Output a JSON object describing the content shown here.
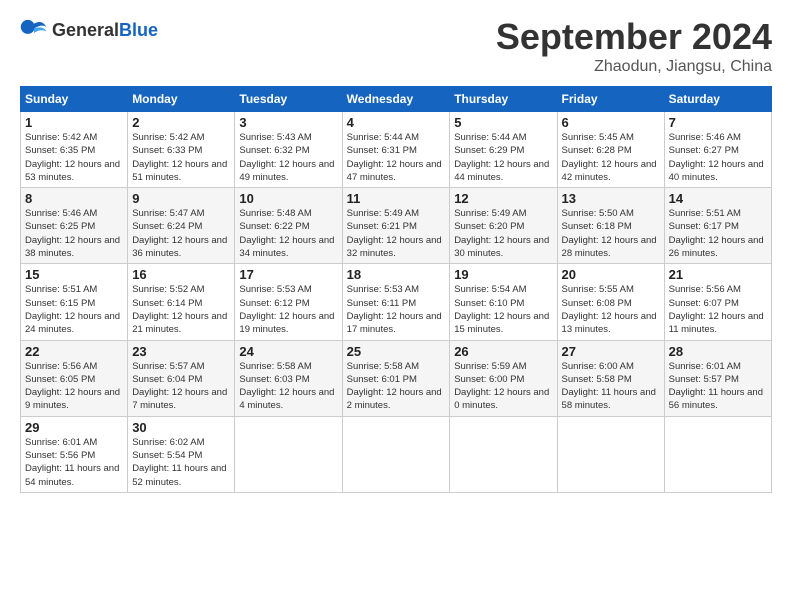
{
  "header": {
    "logo_general": "General",
    "logo_blue": "Blue",
    "title": "September 2024",
    "location": "Zhaodun, Jiangsu, China"
  },
  "weekdays": [
    "Sunday",
    "Monday",
    "Tuesday",
    "Wednesday",
    "Thursday",
    "Friday",
    "Saturday"
  ],
  "weeks": [
    [
      {
        "day": "1",
        "sunrise": "5:42 AM",
        "sunset": "6:35 PM",
        "daylight": "12 hours and 53 minutes."
      },
      {
        "day": "2",
        "sunrise": "5:42 AM",
        "sunset": "6:33 PM",
        "daylight": "12 hours and 51 minutes."
      },
      {
        "day": "3",
        "sunrise": "5:43 AM",
        "sunset": "6:32 PM",
        "daylight": "12 hours and 49 minutes."
      },
      {
        "day": "4",
        "sunrise": "5:44 AM",
        "sunset": "6:31 PM",
        "daylight": "12 hours and 47 minutes."
      },
      {
        "day": "5",
        "sunrise": "5:44 AM",
        "sunset": "6:29 PM",
        "daylight": "12 hours and 44 minutes."
      },
      {
        "day": "6",
        "sunrise": "5:45 AM",
        "sunset": "6:28 PM",
        "daylight": "12 hours and 42 minutes."
      },
      {
        "day": "7",
        "sunrise": "5:46 AM",
        "sunset": "6:27 PM",
        "daylight": "12 hours and 40 minutes."
      }
    ],
    [
      {
        "day": "8",
        "sunrise": "5:46 AM",
        "sunset": "6:25 PM",
        "daylight": "12 hours and 38 minutes."
      },
      {
        "day": "9",
        "sunrise": "5:47 AM",
        "sunset": "6:24 PM",
        "daylight": "12 hours and 36 minutes."
      },
      {
        "day": "10",
        "sunrise": "5:48 AM",
        "sunset": "6:22 PM",
        "daylight": "12 hours and 34 minutes."
      },
      {
        "day": "11",
        "sunrise": "5:49 AM",
        "sunset": "6:21 PM",
        "daylight": "12 hours and 32 minutes."
      },
      {
        "day": "12",
        "sunrise": "5:49 AM",
        "sunset": "6:20 PM",
        "daylight": "12 hours and 30 minutes."
      },
      {
        "day": "13",
        "sunrise": "5:50 AM",
        "sunset": "6:18 PM",
        "daylight": "12 hours and 28 minutes."
      },
      {
        "day": "14",
        "sunrise": "5:51 AM",
        "sunset": "6:17 PM",
        "daylight": "12 hours and 26 minutes."
      }
    ],
    [
      {
        "day": "15",
        "sunrise": "5:51 AM",
        "sunset": "6:15 PM",
        "daylight": "12 hours and 24 minutes."
      },
      {
        "day": "16",
        "sunrise": "5:52 AM",
        "sunset": "6:14 PM",
        "daylight": "12 hours and 21 minutes."
      },
      {
        "day": "17",
        "sunrise": "5:53 AM",
        "sunset": "6:12 PM",
        "daylight": "12 hours and 19 minutes."
      },
      {
        "day": "18",
        "sunrise": "5:53 AM",
        "sunset": "6:11 PM",
        "daylight": "12 hours and 17 minutes."
      },
      {
        "day": "19",
        "sunrise": "5:54 AM",
        "sunset": "6:10 PM",
        "daylight": "12 hours and 15 minutes."
      },
      {
        "day": "20",
        "sunrise": "5:55 AM",
        "sunset": "6:08 PM",
        "daylight": "12 hours and 13 minutes."
      },
      {
        "day": "21",
        "sunrise": "5:56 AM",
        "sunset": "6:07 PM",
        "daylight": "12 hours and 11 minutes."
      }
    ],
    [
      {
        "day": "22",
        "sunrise": "5:56 AM",
        "sunset": "6:05 PM",
        "daylight": "12 hours and 9 minutes."
      },
      {
        "day": "23",
        "sunrise": "5:57 AM",
        "sunset": "6:04 PM",
        "daylight": "12 hours and 7 minutes."
      },
      {
        "day": "24",
        "sunrise": "5:58 AM",
        "sunset": "6:03 PM",
        "daylight": "12 hours and 4 minutes."
      },
      {
        "day": "25",
        "sunrise": "5:58 AM",
        "sunset": "6:01 PM",
        "daylight": "12 hours and 2 minutes."
      },
      {
        "day": "26",
        "sunrise": "5:59 AM",
        "sunset": "6:00 PM",
        "daylight": "12 hours and 0 minutes."
      },
      {
        "day": "27",
        "sunrise": "6:00 AM",
        "sunset": "5:58 PM",
        "daylight": "11 hours and 58 minutes."
      },
      {
        "day": "28",
        "sunrise": "6:01 AM",
        "sunset": "5:57 PM",
        "daylight": "11 hours and 56 minutes."
      }
    ],
    [
      {
        "day": "29",
        "sunrise": "6:01 AM",
        "sunset": "5:56 PM",
        "daylight": "11 hours and 54 minutes."
      },
      {
        "day": "30",
        "sunrise": "6:02 AM",
        "sunset": "5:54 PM",
        "daylight": "11 hours and 52 minutes."
      },
      null,
      null,
      null,
      null,
      null
    ]
  ]
}
